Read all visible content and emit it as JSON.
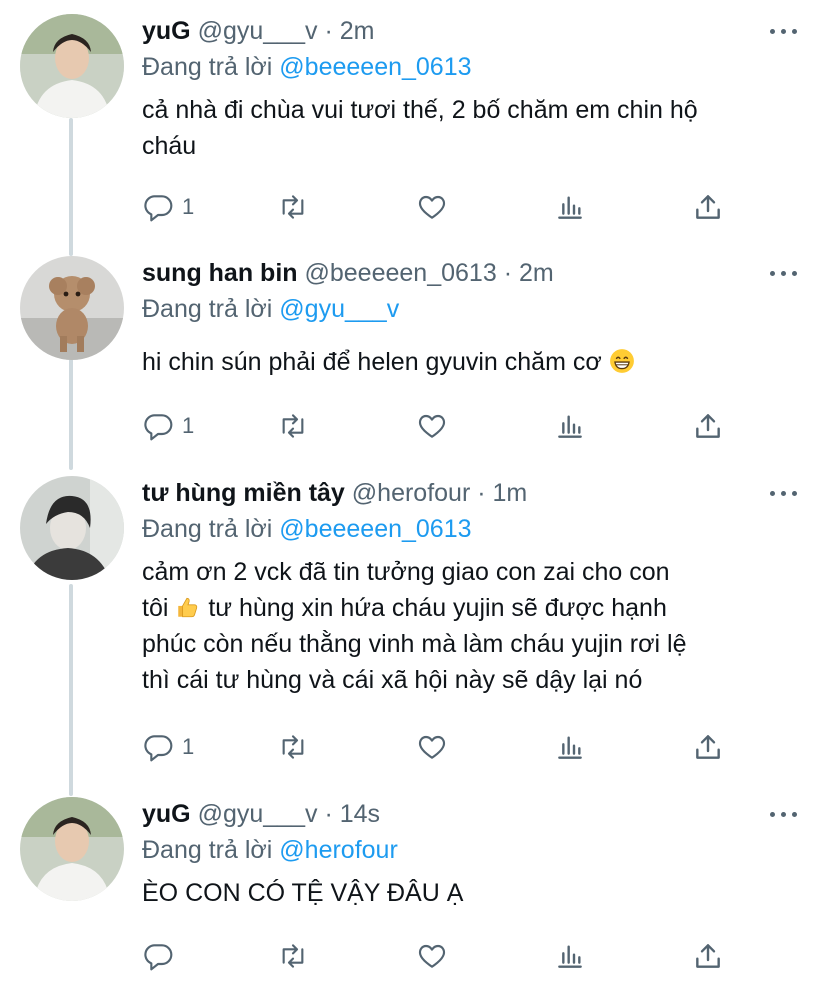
{
  "tweets": [
    {
      "name": "yuG",
      "handle": "@gyu___v",
      "dot": "·",
      "time": "2m",
      "reply_prefix": "Đang trả lời",
      "reply_to": "@beeeeen_0613",
      "text_lines": [
        "cả nhà đi chùa vui tươi thế, 2 bố chăm em chin hộ",
        "cháu"
      ],
      "reply_count": "1",
      "avatar_icon": "person-photo"
    },
    {
      "name": "sung han bin",
      "handle": "@beeeeen_0613",
      "dot": "·",
      "time": "2m",
      "reply_prefix": "Đang trả lời",
      "reply_to": "@gyu___v",
      "text_lines": [
        "hi chin sún phải để helen gyuvin chăm cơ"
      ],
      "reply_count": "1",
      "avatar_icon": "dog-photo"
    },
    {
      "name": "tư hùng miền tây",
      "handle": "@herofour",
      "dot": "·",
      "time": "1m",
      "reply_prefix": "Đang trả lời",
      "reply_to": "@beeeeen_0613",
      "text_lines": [
        "cảm ơn 2 vck đã tin tưởng giao con zai cho con",
        "tôi",
        "tư hùng xin hứa cháu yujin sẽ được hạnh",
        "phúc còn nếu thằng vinh mà làm cháu yujin rơi lệ",
        "thì cái tư hùng và cái xã hội này sẽ dậy lại nó"
      ],
      "reply_count": "1",
      "avatar_icon": "person-photo-bw"
    },
    {
      "name": "yuG",
      "handle": "@gyu___v",
      "dot": "·",
      "time": "14s",
      "reply_prefix": "Đang trả lời",
      "reply_to": "@herofour",
      "text_lines": [
        "ÈO CON CÓ TỆ VẬY ĐÂU Ạ"
      ],
      "reply_count": "",
      "avatar_icon": "person-photo"
    }
  ],
  "icons": {
    "reply": "reply-icon",
    "retweet": "retweet-icon",
    "like": "heart-icon",
    "analytics": "analytics-icon",
    "share": "share-icon",
    "more": "more-icon",
    "grin": "grinning-emoji",
    "thumbs": "thumbs-up-emoji"
  },
  "colors": {
    "link": "#1d9bf0",
    "secondary": "#536471",
    "text": "#0f1419",
    "thread_line": "#cfd9de"
  }
}
